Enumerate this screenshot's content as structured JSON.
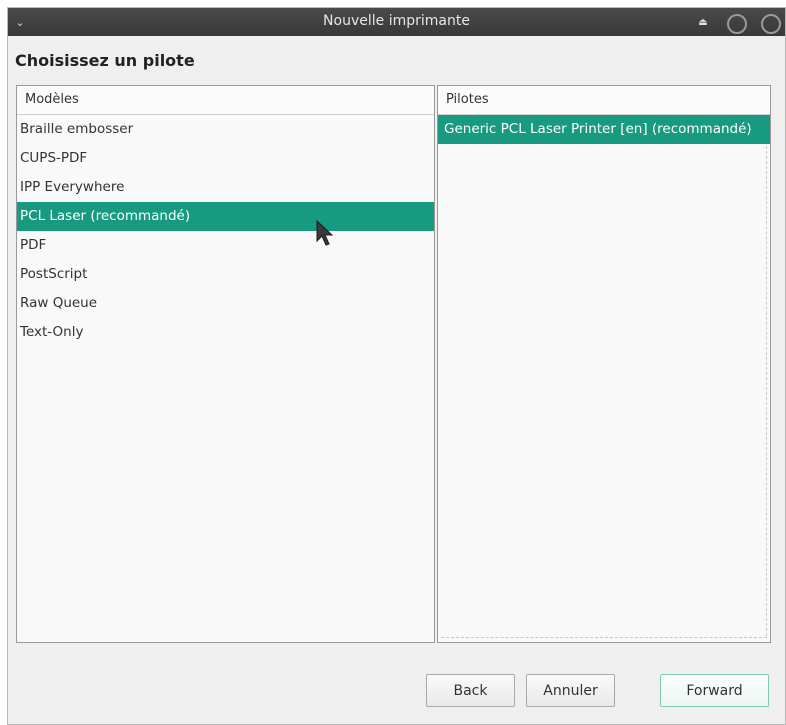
{
  "window": {
    "title": "Nouvelle imprimante",
    "menu_icon": "chevron-down-icon",
    "controls": [
      "eject-icon",
      "minimize-icon",
      "close-icon"
    ]
  },
  "heading": "Choisissez un pilote",
  "models": {
    "header": "Modèles",
    "items": [
      {
        "label": "Braille embosser"
      },
      {
        "label": "CUPS-PDF"
      },
      {
        "label": "IPP Everywhere"
      },
      {
        "label": "PCL Laser (recommandé)",
        "selected": true
      },
      {
        "label": "PDF"
      },
      {
        "label": "PostScript"
      },
      {
        "label": "Raw Queue"
      },
      {
        "label": "Text-Only"
      }
    ]
  },
  "drivers": {
    "header": "Pilotes",
    "items": [
      {
        "label": "Generic PCL Laser Printer [en] (recommandé)",
        "selected": true
      }
    ]
  },
  "buttons": {
    "back": "Back",
    "cancel": "Annuler",
    "forward": "Forward"
  },
  "colors": {
    "selection": "#179a7f",
    "titlebar": "#3c3c3c"
  }
}
